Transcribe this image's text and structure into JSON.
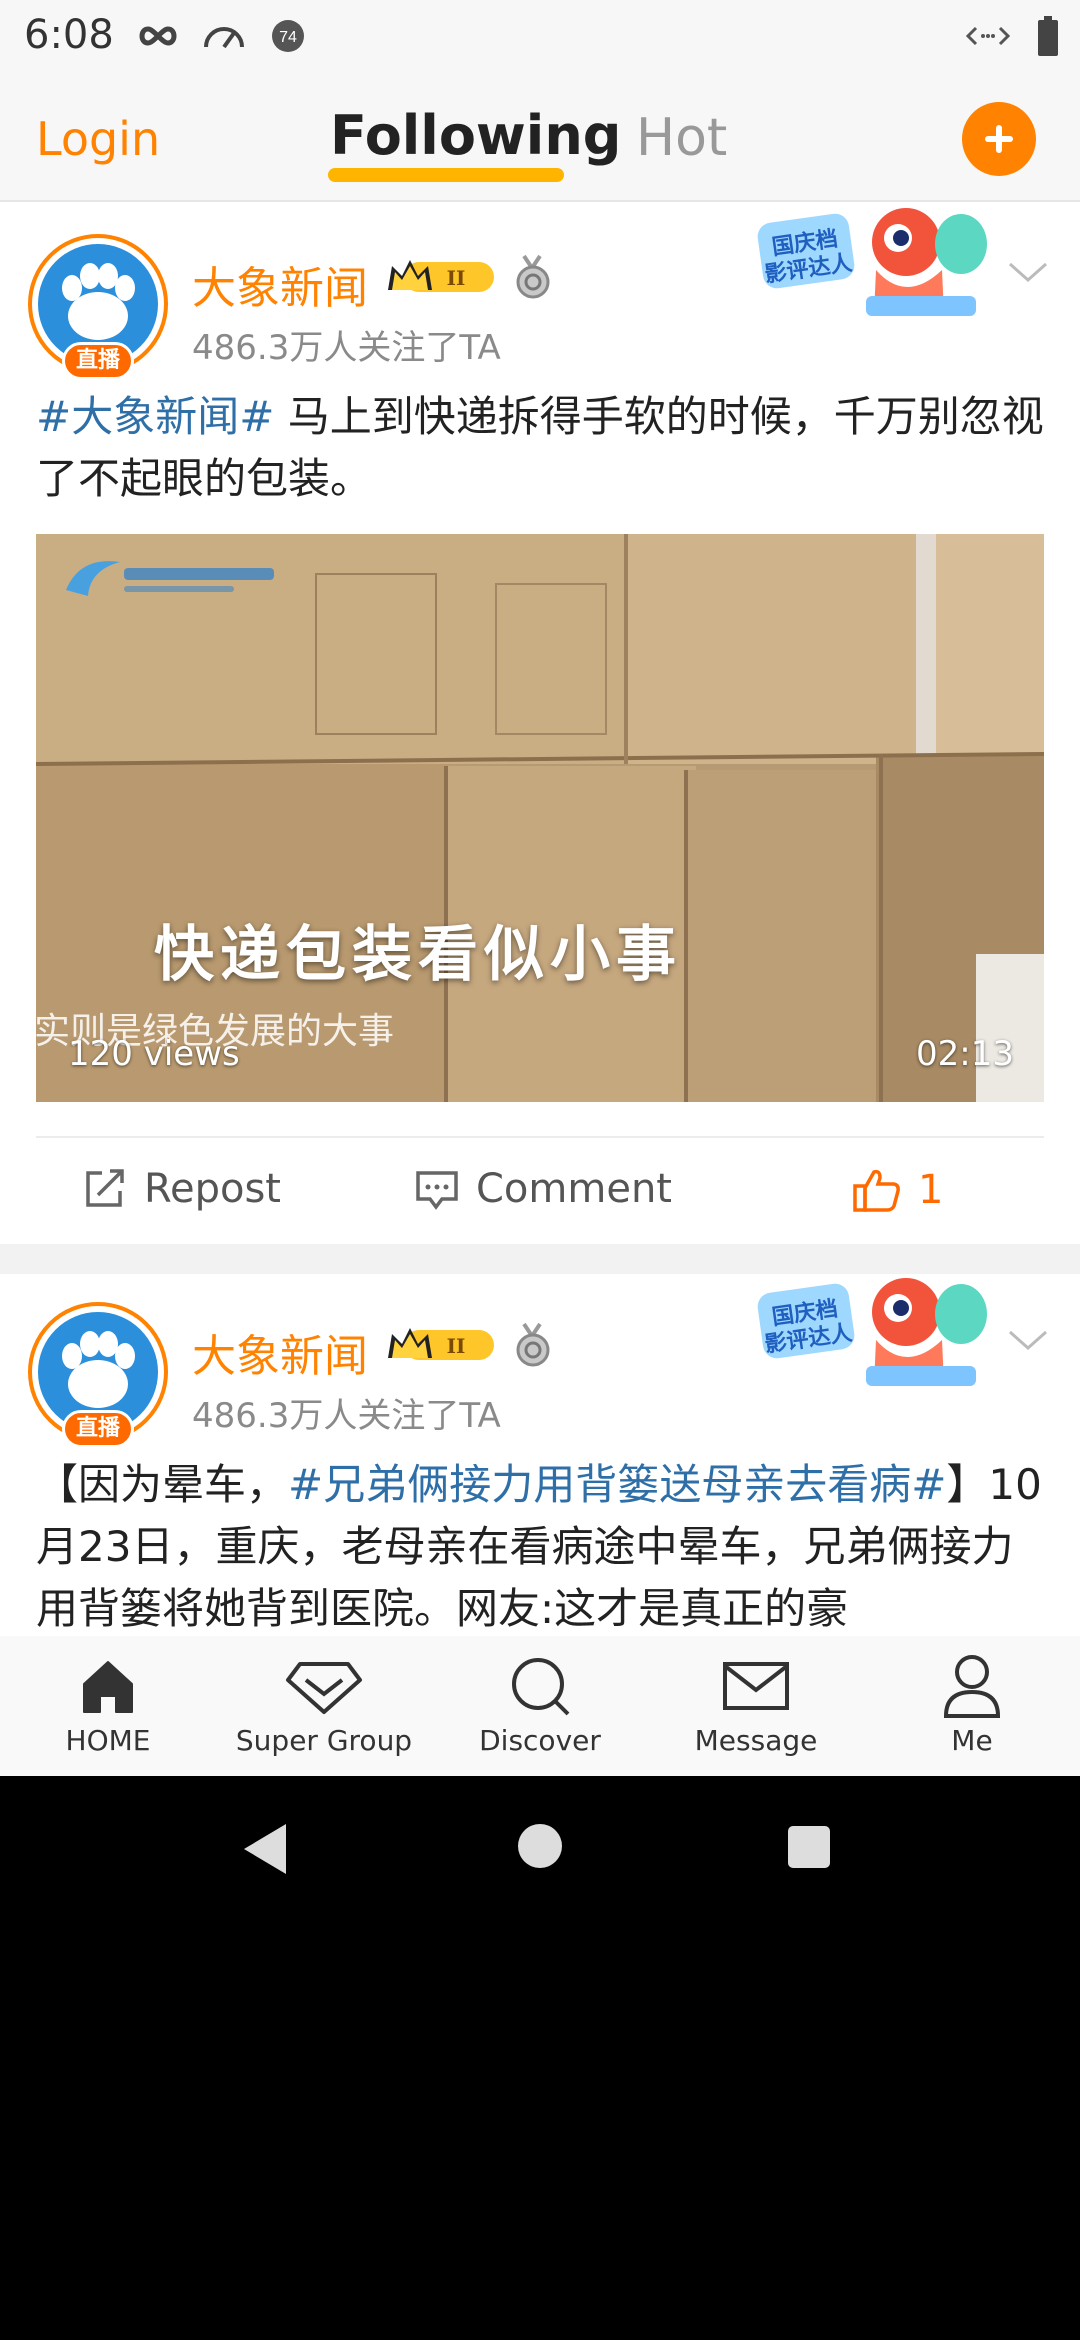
{
  "status_bar": {
    "time": "6:08",
    "notification_count": "74"
  },
  "top_nav": {
    "login": "Login",
    "tabs": [
      {
        "label": "Following",
        "active": true
      },
      {
        "label": "Hot",
        "active": false
      }
    ],
    "add_icon": "plus-icon"
  },
  "posts": [
    {
      "username": "大象新闻",
      "live_badge": "直播",
      "level_badge": "II",
      "followers": "486.3万人关注了TA",
      "text_hashtag": "#大象新闻#",
      "text_body": " 马上到快递拆得手软的时候，千万别忽视了不起眼的包装。",
      "video": {
        "overlay_title": "快递包装看似小事",
        "overlay_subtitle": "实则是绿色发展的大事",
        "views": "120 views",
        "duration": "02:13"
      },
      "actions": {
        "repost": "Repost",
        "comment": "Comment",
        "likes": "1"
      }
    },
    {
      "username": "大象新闻",
      "live_badge": "直播",
      "level_badge": "II",
      "followers": "486.3万人关注了TA",
      "text_prefix": "【因为晕车，",
      "text_hashtag": "#兄弟俩接力用背篓送母亲去看病#",
      "text_body": "】10月23日，重庆，老母亲在看病途中晕车，兄弟俩接力用背篓将她背到医院。网友:这才是真正的豪"
    }
  ],
  "tabbar": [
    {
      "label": "HOME",
      "icon": "home-icon"
    },
    {
      "label": "Super Group",
      "icon": "diamond-icon"
    },
    {
      "label": "Discover",
      "icon": "search-icon"
    },
    {
      "label": "Message",
      "icon": "mail-icon"
    },
    {
      "label": "Me",
      "icon": "person-icon"
    }
  ],
  "colors": {
    "accent": "#ff8200",
    "hashtag": "#2f6fa8"
  }
}
